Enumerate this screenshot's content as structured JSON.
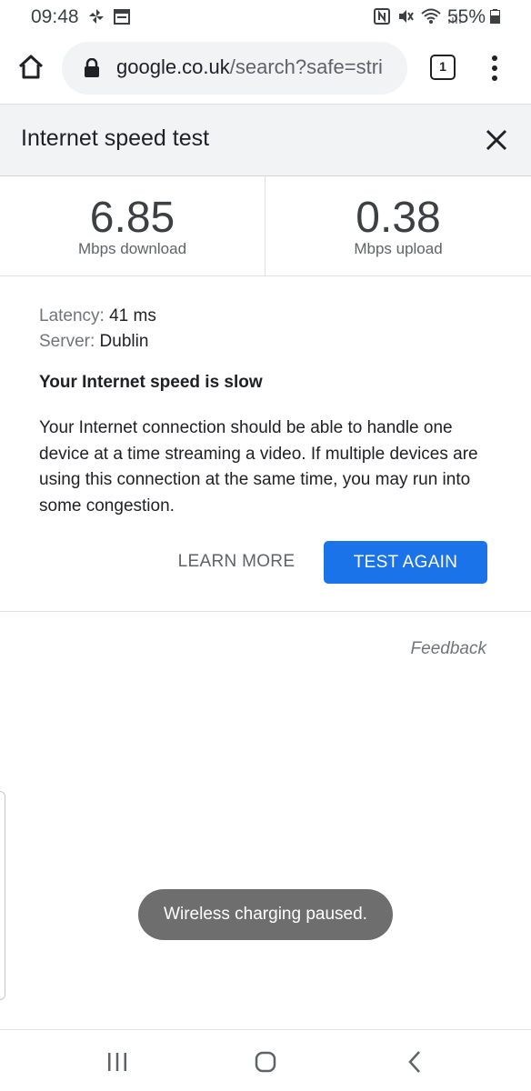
{
  "status_bar": {
    "time": "09:48",
    "battery": "55%",
    "left_icons": [
      "pinwheel-icon",
      "calendar-icon"
    ],
    "right_icons": [
      "nfc-icon",
      "mute-icon",
      "wifi-icon",
      "signal-icon",
      "battery-icon"
    ]
  },
  "browser": {
    "url_domain": "google.co.uk",
    "url_path": "/search?safe=stri",
    "tab_count": "1"
  },
  "card": {
    "title": "Internet speed test"
  },
  "results": {
    "download_value": "6.85",
    "download_label": "Mbps download",
    "upload_value": "0.38",
    "upload_label": "Mbps upload"
  },
  "details": {
    "latency_key": "Latency:",
    "latency_value": "41 ms",
    "server_key": "Server:",
    "server_value": "Dublin",
    "verdict": "Your Internet speed is slow",
    "explanation": "Your Internet connection should be able to handle one device at a time streaming a video. If multiple devices are using this connection at the same time, you may run into some congestion."
  },
  "actions": {
    "learn_more": "LEARN MORE",
    "test_again": "TEST AGAIN",
    "feedback": "Feedback"
  },
  "toast": {
    "message": "Wireless charging paused."
  },
  "colors": {
    "accent": "#1a73e8",
    "toast_bg": "#6e6e6e",
    "header_bg": "#f1f3f4"
  }
}
